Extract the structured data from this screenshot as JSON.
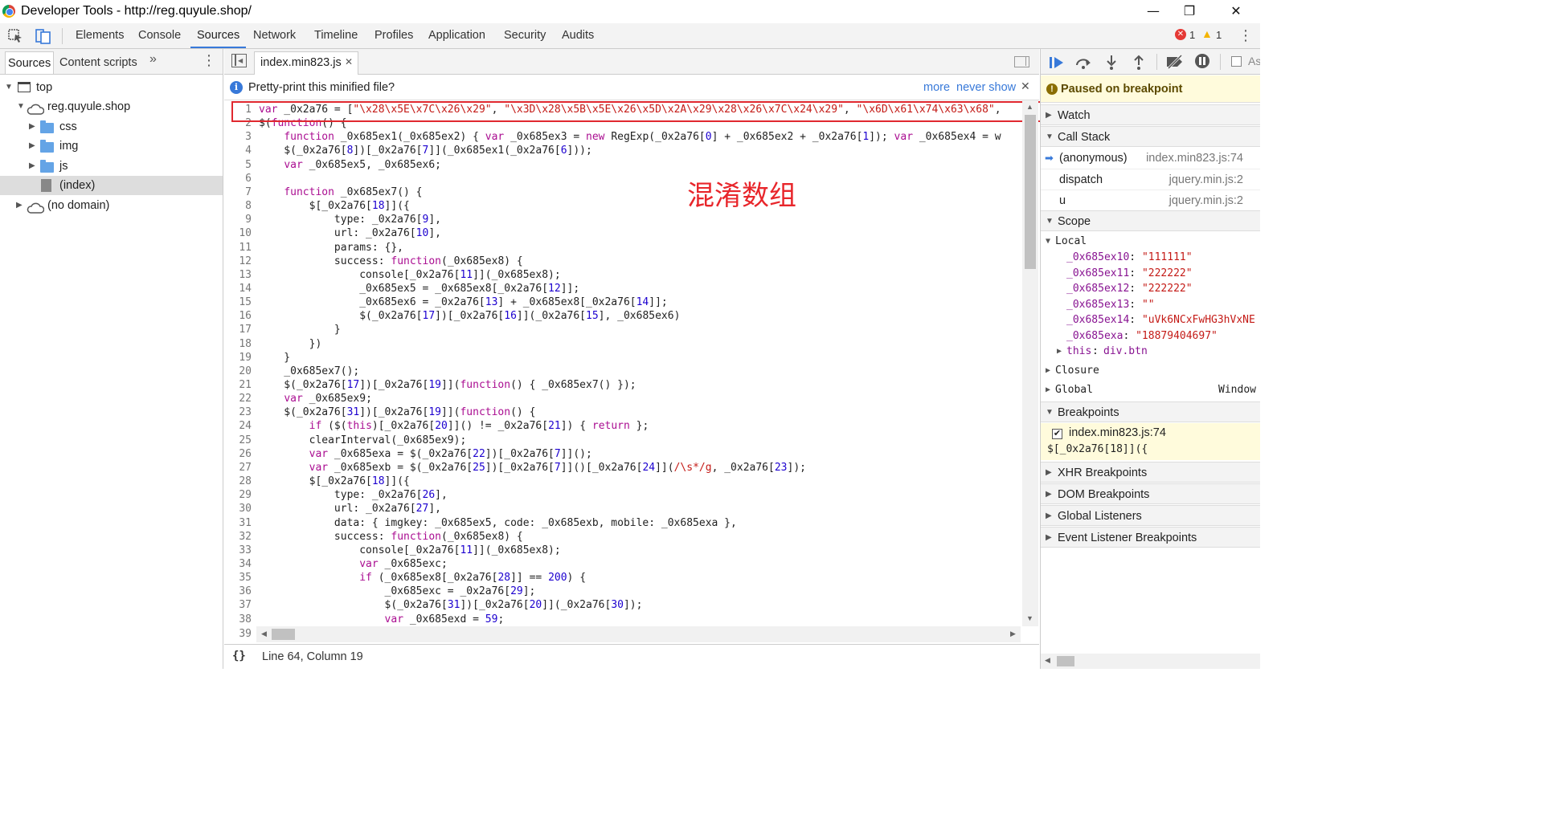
{
  "window": {
    "title": "Developer Tools - http://reg.quyule.shop/",
    "minimize": "—",
    "restore": "❐",
    "close": "✕"
  },
  "toolbar": {
    "tabs": [
      "Elements",
      "Console",
      "Sources",
      "Network",
      "Timeline",
      "Profiles",
      "Application",
      "Security",
      "Audits"
    ],
    "active_tab": "Sources",
    "error_count": "1",
    "warning_count": "1"
  },
  "navigator": {
    "tabs": [
      "Sources",
      "Content scripts"
    ],
    "more": "»",
    "tree": [
      "top",
      "reg.quyule.shop",
      "css",
      "img",
      "js",
      "(index)",
      "(no domain)"
    ]
  },
  "editor": {
    "file_tab": "index.min823.js",
    "infobar": {
      "message": "Pretty-print this minified file?",
      "more": "more",
      "never_show": "never show"
    },
    "annotation": "混淆数组",
    "status_line": "Line 64, Column 19",
    "format_icon": "{}",
    "lines": [
      "var _0x2a76 = [\"\\x28\\x5E\\x7C\\x26\\x29\", \"\\x3D\\x28\\x5B\\x5E\\x26\\x5D\\x2A\\x29\\x28\\x26\\x7C\\x24\\x29\", \"\\x6D\\x61\\x74\\x63\\x68\",",
      "$(function() {",
      "    function _0x685ex1(_0x685ex2) { var _0x685ex3 = new RegExp(_0x2a76[0] + _0x685ex2 + _0x2a76[1]); var _0x685ex4 = w",
      "    $(_0x2a76[8])[_0x2a76[7]](_0x685ex1(_0x2a76[6]));",
      "    var _0x685ex5, _0x685ex6;",
      "",
      "    function _0x685ex7() {",
      "        $[_0x2a76[18]]({",
      "            type: _0x2a76[9],",
      "            url: _0x2a76[10],",
      "            params: {},",
      "            success: function(_0x685ex8) {",
      "                console[_0x2a76[11]](_0x685ex8);",
      "                _0x685ex5 = _0x685ex8[_0x2a76[12]];",
      "                _0x685ex6 = _0x2a76[13] + _0x685ex8[_0x2a76[14]];",
      "                $(_0x2a76[17])[_0x2a76[16]](_0x2a76[15], _0x685ex6)",
      "            }",
      "        })",
      "    }",
      "    _0x685ex7();",
      "    $(_0x2a76[17])[_0x2a76[19]](function() { _0x685ex7() });",
      "    var _0x685ex9;",
      "    $(_0x2a76[31])[_0x2a76[19]](function() {",
      "        if ($(this)[_0x2a76[20]]() != _0x2a76[21]) { return };",
      "        clearInterval(_0x685ex9);",
      "        var _0x685exa = $(_0x2a76[22])[_0x2a76[7]]();",
      "        var _0x685exb = $(_0x2a76[25])[_0x2a76[7]]()[_0x2a76[24]](/\\s*/g, _0x2a76[23]);",
      "        $[_0x2a76[18]]({",
      "            type: _0x2a76[26],",
      "            url: _0x2a76[27],",
      "            data: { imgkey: _0x685ex5, code: _0x685exb, mobile: _0x685exa },",
      "            success: function(_0x685ex8) {",
      "                console[_0x2a76[11]](_0x685ex8);",
      "                var _0x685exc;",
      "                if (_0x685ex8[_0x2a76[28]] == 200) {",
      "                    _0x685exc = _0x2a76[29];",
      "                    $(_0x2a76[31])[_0x2a76[20]](_0x2a76[30]);",
      "                    var _0x685exd = 59;",
      ""
    ]
  },
  "debugger": {
    "paused": "Paused on breakpoint",
    "watch": "Watch",
    "call_stack": "Call Stack",
    "frames": [
      {
        "name": "(anonymous)",
        "loc": "index.min823.js:74"
      },
      {
        "name": "dispatch",
        "loc": "jquery.min.js:2"
      },
      {
        "name": "u",
        "loc": "jquery.min.js:2"
      }
    ],
    "scope": "Scope",
    "local": "Local",
    "vars": [
      {
        "name": "_0x685ex10",
        "value": "\"111111\""
      },
      {
        "name": "_0x685ex11",
        "value": "\"222222\""
      },
      {
        "name": "_0x685ex12",
        "value": "\"222222\""
      },
      {
        "name": "_0x685ex13",
        "value": "\"\""
      },
      {
        "name": "_0x685ex14",
        "value": "\"uVk6NCxFwHG3hVxNE"
      },
      {
        "name": "_0x685exa",
        "value": "\"18879404697\""
      }
    ],
    "this_name": "this",
    "this_value": "div.btn",
    "closure": "Closure",
    "global": "Global",
    "global_value": "Window",
    "breakpoints": "Breakpoints",
    "bp_file": "index.min823.js:74",
    "bp_code": "$[_0x2a76[18]]({",
    "xhr": "XHR Breakpoints",
    "dom": "DOM Breakpoints",
    "listeners": "Global Listeners",
    "event_listeners": "Event Listener Breakpoints",
    "async_label": "As"
  },
  "colors": {
    "accent": "#3879d9",
    "highlight_box": "#e0282f",
    "annotation": "#e8262b",
    "paused_bg": "#fffbdc"
  }
}
